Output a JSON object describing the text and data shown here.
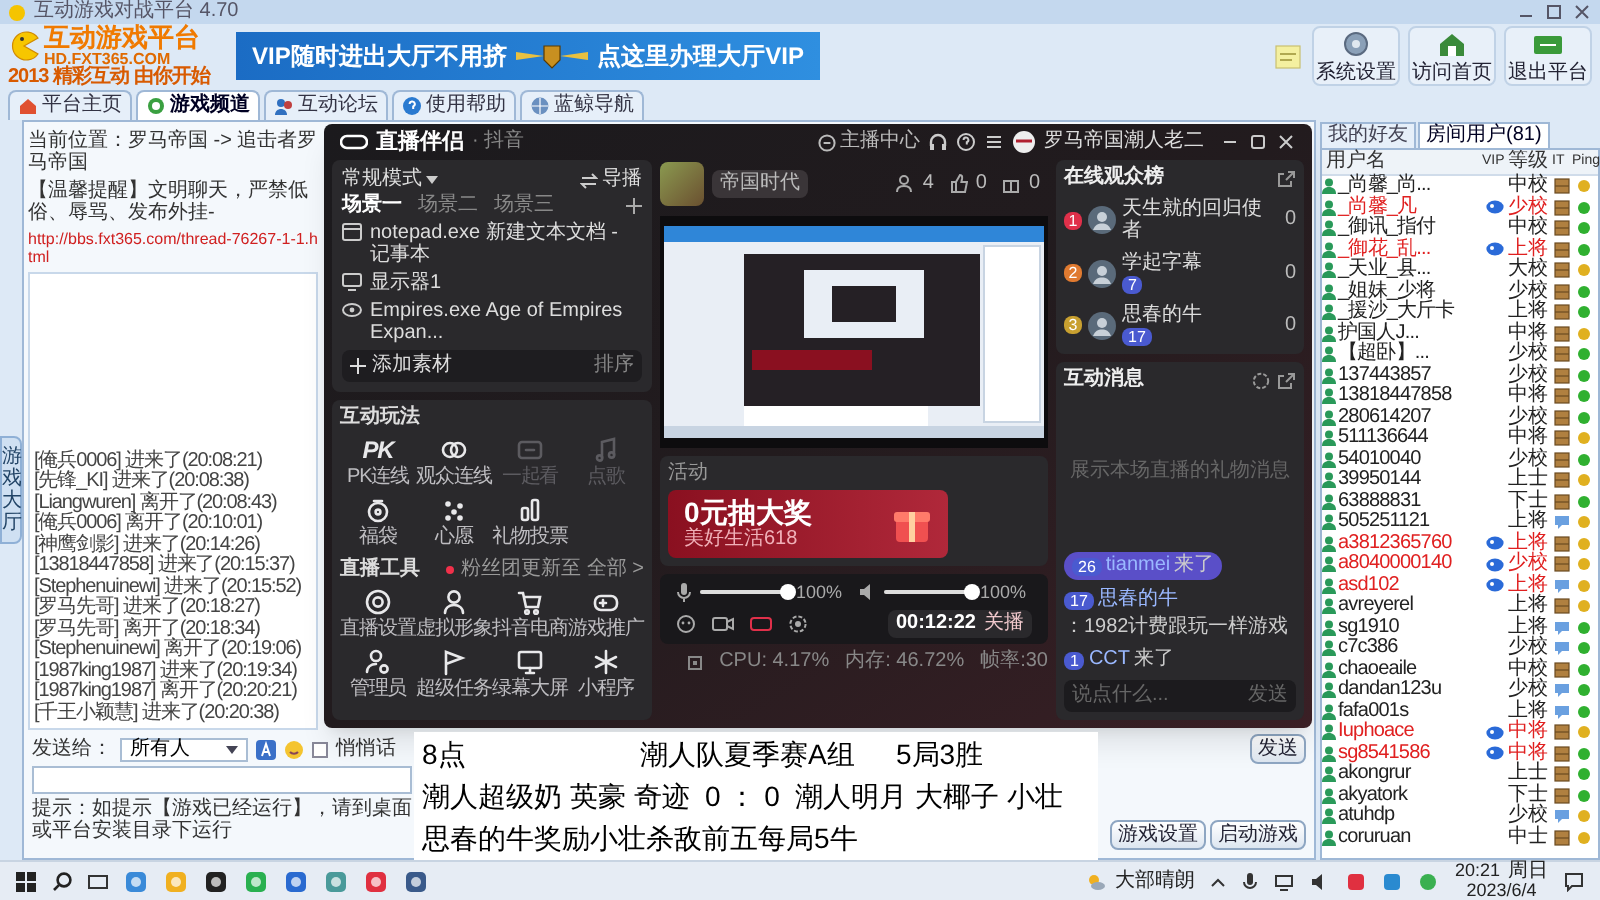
{
  "app": {
    "title": "互动游戏对战平台 4.70",
    "logo": {
      "title": "互动游戏平台",
      "url": "HD.FXT365.COM",
      "slogan": "2013 精彩互动 由你开始"
    },
    "banner": {
      "left": "VIP随时进出大厅不用挤",
      "right": "点这里办理大厅VIP"
    },
    "toolbar": [
      {
        "label": "系统设置"
      },
      {
        "label": "访问首页"
      },
      {
        "label": "退出平台"
      }
    ],
    "tabs": [
      {
        "label": "平台主页",
        "selected": false
      },
      {
        "label": "游戏频道",
        "selected": true
      },
      {
        "label": "互动论坛",
        "selected": false
      },
      {
        "label": "使用帮助",
        "selected": false
      },
      {
        "label": "蓝鲸导航",
        "selected": false
      }
    ],
    "side_tab": "游戏大厅",
    "breadcrumb": "当前位置：罗马帝国 -> 追击者罗马帝国",
    "notice": "【温馨提醒】文明聊天，严禁低俗、辱骂、发布外挂-",
    "link": "http://bbs.fxt365.com/thread-76267-1-1.html",
    "chat_log": [
      "[俺兵0006] 进来了(20:08:21)",
      "[先锋_KI] 进来了(20:08:38)",
      "[Liangwuren] 离开了(20:08:43)",
      "[俺兵0006] 离开了(20:10:01)",
      "[神鹰剑影] 进来了(20:14:26)",
      "[13818447858] 进来了(20:15:37)",
      "[Stephenuinewi] 进来了(20:15:52)",
      "[罗马先哥] 进来了(20:18:27)",
      "[罗马先哥] 离开了(20:18:34)",
      "[Stephenuinewi] 离开了(20:19:06)",
      "[1987king1987] 进来了(20:19:34)",
      "[1987king1987] 离开了(20:20:21)",
      "[千王小颖慧] 进来了(20:20:38)"
    ],
    "send_label": "发送给：",
    "send_target": "所有人",
    "whisper": {
      "label": "悄悄话",
      "checked": false
    },
    "send_button": "发送",
    "tip": "提示：如提示【游戏已经运行】，请到桌面或平台安装目录下运行",
    "buttons": [
      "游戏设置",
      "启动游戏"
    ],
    "user_tabs": [
      {
        "label": "我的好友",
        "selected": false
      },
      {
        "label": "房间用户(81)",
        "selected": true
      }
    ],
    "user_columns": [
      "用户名",
      "VIP",
      "等级",
      "IT",
      "Ping"
    ],
    "users": [
      {
        "name": "_尚馨_尚...",
        "vip": false,
        "rank": "中校",
        "kind": "box",
        "color": "#e0b020"
      },
      {
        "name": "_尚馨_凡",
        "vip": true,
        "rank": "少校",
        "kind": "box",
        "color": "#30b030"
      },
      {
        "name": "_御讯_指付",
        "vip": false,
        "rank": "中校",
        "kind": "box",
        "color": "#30b030"
      },
      {
        "name": "_御花_乱...",
        "vip": true,
        "rank": "上将",
        "kind": "box",
        "color": "#30b030"
      },
      {
        "name": "_天业_县...",
        "vip": false,
        "rank": "大校",
        "kind": "box",
        "color": "#e0b020"
      },
      {
        "name": "_姐妹_少将",
        "vip": false,
        "rank": "少校",
        "kind": "box",
        "color": "#30b030"
      },
      {
        "name": "_援沙_大斤卡",
        "vip": false,
        "rank": "上将",
        "kind": "box",
        "color": "#30b030"
      },
      {
        "name": "护国人J...",
        "vip": false,
        "rank": "中将",
        "kind": "box",
        "color": "#e0b020"
      },
      {
        "name": "【超卧】...",
        "vip": false,
        "rank": "少校",
        "kind": "box",
        "color": "#30b030"
      },
      {
        "name": "137443857",
        "vip": false,
        "rank": "少校",
        "kind": "box",
        "color": "#30b030"
      },
      {
        "name": "13818447858",
        "vip": false,
        "rank": "中将",
        "kind": "box",
        "color": "#30b030"
      },
      {
        "name": "280614207",
        "vip": false,
        "rank": "少校",
        "kind": "box",
        "color": "#30b030"
      },
      {
        "name": "511136644",
        "vip": false,
        "rank": "中将",
        "kind": "box",
        "color": "#e0b020"
      },
      {
        "name": "54010040",
        "vip": false,
        "rank": "少校",
        "kind": "box",
        "color": "#30b030"
      },
      {
        "name": "39950144",
        "vip": false,
        "rank": "上士",
        "kind": "box",
        "color": "#e0b020"
      },
      {
        "name": "63888831",
        "vip": false,
        "rank": "下士",
        "kind": "box",
        "color": "#30b030"
      },
      {
        "name": "505251121",
        "vip": false,
        "rank": "上将",
        "kind": "bubble",
        "color": "#e0b020"
      },
      {
        "name": "a3812365760",
        "vip": true,
        "rank": "上将",
        "kind": "box",
        "color": "#e0b020"
      },
      {
        "name": "a8040000140",
        "vip": true,
        "rank": "少校",
        "kind": "box",
        "color": "#e0b020"
      },
      {
        "name": "asd102",
        "vip": true,
        "rank": "上将",
        "kind": "bubble",
        "color": "#e0b020"
      },
      {
        "name": "avreyerel",
        "vip": false,
        "rank": "上将",
        "kind": "box",
        "color": "#e0b020"
      },
      {
        "name": "sg1910",
        "vip": false,
        "rank": "上将",
        "kind": "bubble",
        "color": "#30b030"
      },
      {
        "name": "c7c386",
        "vip": false,
        "rank": "少校",
        "kind": "bubble",
        "color": "#30b030"
      },
      {
        "name": "chaoeaile",
        "vip": false,
        "rank": "中校",
        "kind": "box",
        "color": "#30b030"
      },
      {
        "name": "dandan123u",
        "vip": false,
        "rank": "少校",
        "kind": "bubble",
        "color": "#30b030"
      },
      {
        "name": "fafa001s",
        "vip": false,
        "rank": "上将",
        "kind": "bubble",
        "color": "#30b030"
      },
      {
        "name": "Iuphoace",
        "vip": true,
        "rank": "中将",
        "kind": "box",
        "color": "#e0b020"
      },
      {
        "name": "sg8541586",
        "vip": true,
        "rank": "中将",
        "kind": "box",
        "color": "#30b030"
      },
      {
        "name": "akongrur",
        "vip": false,
        "rank": "上士",
        "kind": "box",
        "color": "#30b030"
      },
      {
        "name": "akyatork",
        "vip": false,
        "rank": "下士",
        "kind": "box",
        "color": "#30b030"
      },
      {
        "name": "atuhdp",
        "vip": false,
        "rank": "少校",
        "kind": "bubble",
        "color": "#e0b020"
      },
      {
        "name": "coruruan",
        "vip": false,
        "rank": "中士",
        "kind": "box",
        "color": "#e0b020"
      }
    ]
  },
  "stream": {
    "brand": "直播伴侣",
    "platform": "· 抖音",
    "center": "主播中心",
    "user": "罗马帝国潮人老二",
    "mode": "常规模式",
    "director": "导播",
    "scenes": [
      {
        "label": "场景一",
        "selected": true
      },
      {
        "label": "场景二",
        "selected": false
      },
      {
        "label": "场景三",
        "selected": false
      }
    ],
    "sources": [
      {
        "kind": "window",
        "label": "notepad.exe 新建文本文档 - 记事本"
      },
      {
        "kind": "display",
        "label": "显示器1"
      },
      {
        "kind": "game",
        "label": "Empires.exe Age of Empires Expan..."
      }
    ],
    "add_source": "添加素材",
    "sort": "排序",
    "play": {
      "title": "互动玩法",
      "items": [
        {
          "label": "PK连线",
          "glyph": "PK",
          "disabled": false
        },
        {
          "label": "观众连线",
          "disabled": false
        },
        {
          "label": "一起看",
          "disabled": true
        },
        {
          "label": "点歌",
          "disabled": true
        },
        {
          "label": "福袋",
          "disabled": false
        },
        {
          "label": "心愿",
          "disabled": false
        },
        {
          "label": "礼物投票",
          "disabled": false
        }
      ]
    },
    "tools": {
      "title": "直播工具",
      "notice": "粉丝团更新至",
      "more": "全部 >",
      "items": [
        {
          "label": "直播设置"
        },
        {
          "label": "虚拟形象"
        },
        {
          "label": "抖音电商"
        },
        {
          "label": "游戏推广"
        },
        {
          "label": "管理员"
        },
        {
          "label": "超级任务"
        },
        {
          "label": "绿幕大屏"
        },
        {
          "label": "小程序"
        }
      ]
    },
    "category": "帝国时代",
    "stats": [
      "4",
      "0",
      "0"
    ],
    "activity": {
      "title": "活动",
      "promo": "0元抽大奖",
      "promo_sub": "美好生活618"
    },
    "mic": {
      "level": 1,
      "reading": "100%"
    },
    "speaker": {
      "level": 1,
      "reading": "100%"
    },
    "timer": "00:12:22",
    "end_button": "关播",
    "status": [
      "CPU: 4.17%",
      "内存: 46.72%",
      "帧率:30"
    ],
    "viewers": {
      "title": "在线观众榜",
      "items": [
        {
          "rank": "1",
          "name": "天生就的回归使者",
          "score": "0",
          "color": "#e0304a"
        },
        {
          "rank": "2",
          "name": "学起字幕",
          "badge": "7",
          "score": "0",
          "color": "#e07a30"
        },
        {
          "rank": "3",
          "name": "思春的牛",
          "badge": "17",
          "score": "0",
          "color": "#c8a030"
        }
      ]
    },
    "messages": {
      "title": "互动消息",
      "placeholder": "展示本场直播的礼物消息",
      "items": [
        {
          "badge": "26",
          "user": "tianmei",
          "text": "来了",
          "highlighted": true
        },
        {
          "badge": "17",
          "user": "思春的牛",
          "text": "：1982计费跟玩一样游戏",
          "highlighted": false
        },
        {
          "badge": "1",
          "user": "CCT",
          "text": "来了",
          "highlighted": false
        }
      ],
      "input_placeholder": "说点什么...",
      "send": "发送"
    }
  },
  "caption": [
    [
      "8点",
      "潮人队夏季赛A组",
      "5局3胜"
    ],
    [
      "潮人超级奶 英豪 奇迹  0 ： 0  潮人明月 大椰子 小壮"
    ],
    [
      "思春的牛奖励小壮杀敌前五每局5牛"
    ]
  ],
  "taskbar": {
    "weather": "大部晴朗",
    "time": "20:21",
    "day": "周日",
    "date": "2023/6/4"
  }
}
